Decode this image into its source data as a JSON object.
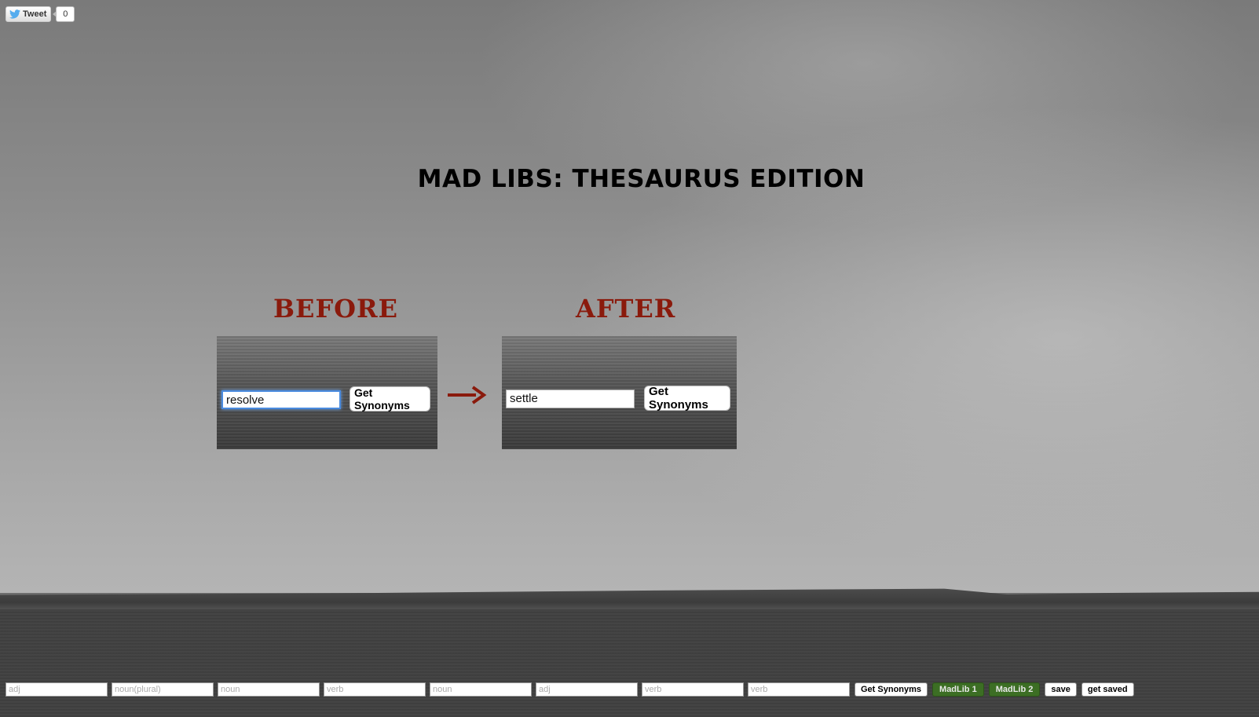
{
  "tweet": {
    "label": "Tweet",
    "count": "0"
  },
  "title": "MAD LIBS: THESAURUS EDITION",
  "example": {
    "before_heading": "BEFORE",
    "after_heading": "AFTER",
    "before_value": "resolve",
    "after_value": "settle",
    "button_label": "Get Synonyms",
    "arrow": "—>"
  },
  "form": {
    "fields": [
      {
        "placeholder": "adj",
        "value": ""
      },
      {
        "placeholder": "noun(plural)",
        "value": ""
      },
      {
        "placeholder": "noun",
        "value": ""
      },
      {
        "placeholder": "verb",
        "value": ""
      },
      {
        "placeholder": "noun",
        "value": ""
      },
      {
        "placeholder": "adj",
        "value": ""
      },
      {
        "placeholder": "verb",
        "value": ""
      },
      {
        "placeholder": "verb",
        "value": ""
      }
    ],
    "get_synonyms_label": "Get Synonyms",
    "madlib1_label": "MadLib 1",
    "madlib2_label": "MadLib 2",
    "save_label": "save",
    "get_saved_label": "get saved"
  },
  "colors": {
    "heading_red": "#8a1a0c",
    "madlib_green": "#3c6e24",
    "twitter_blue": "#55acee"
  }
}
